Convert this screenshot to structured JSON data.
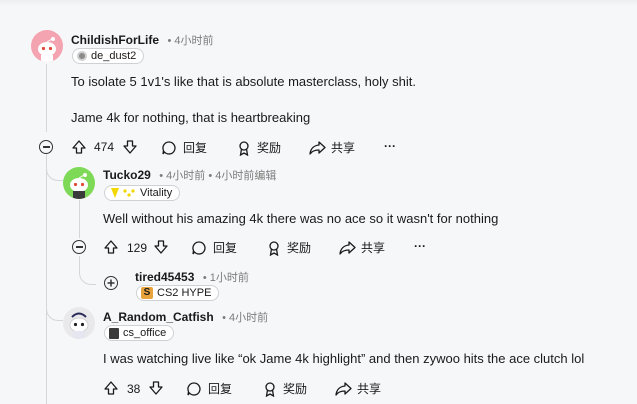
{
  "comments": {
    "c1": {
      "username": "ChildishForLife",
      "time": "• 4小时前",
      "flair": "de_dust2",
      "lines": [
        "To isolate 5 1v1's like that is absolute masterclass, holy shit.",
        "Jame 4k for nothing, that is heartbreaking"
      ],
      "votes": "474",
      "reply": "回复",
      "award": "奖励",
      "share": "共享",
      "more": "···"
    },
    "c2": {
      "username": "Tucko29",
      "time": "• 4小时前 • 4小时前编辑",
      "flair": "Vitality",
      "lines": [
        "Well without his amazing 4k there was no ace so it wasn't for nothing"
      ],
      "votes": "129",
      "reply": "回复",
      "award": "奖励",
      "share": "共享",
      "more": "···"
    },
    "c3": {
      "username": "tired45453",
      "time": "• 1小时前",
      "flair": "CS2 HYPE"
    },
    "c4": {
      "username": "A_Random_Catfish",
      "time": "• 4小时前",
      "flair": "cs_office",
      "lines": [
        "I was watching live like “ok Jame 4k highlight” and then zywoo hits the ace clutch lol"
      ],
      "votes": "38",
      "reply": "回复",
      "award": "奖励",
      "share": "共享"
    }
  },
  "colors": {
    "background": "#f6f7f8",
    "thread_line": "#d4d7da",
    "avatar1": "#f4a3b0",
    "avatar2": "#7ed957",
    "vitality": "#f2d700"
  }
}
